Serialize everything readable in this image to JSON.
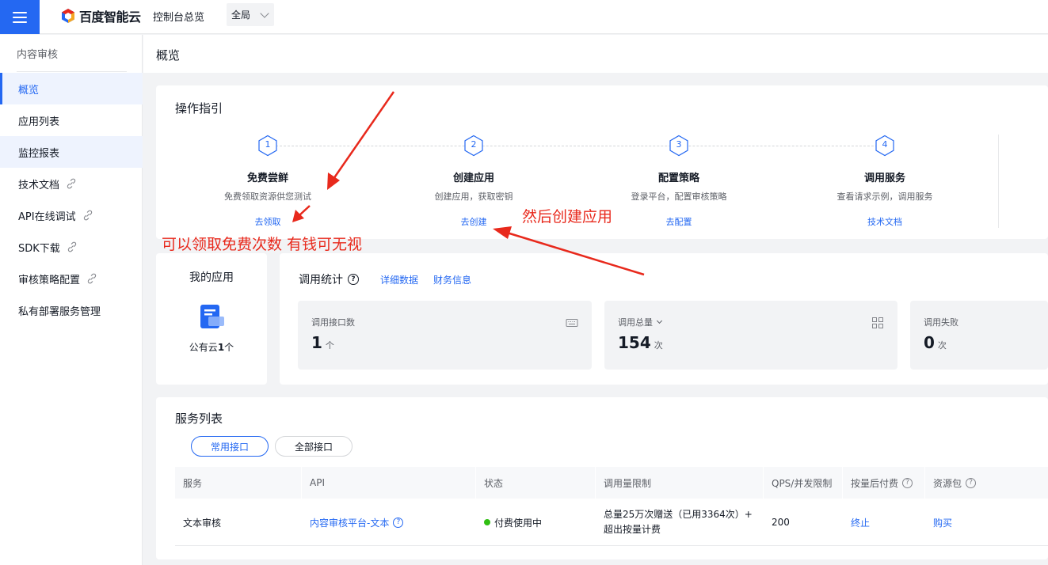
{
  "topbar": {
    "logo_text": "百度智能云",
    "console_link": "控制台总览",
    "region": "全局"
  },
  "sidebar": {
    "title": "内容审核",
    "items": [
      {
        "label": "概览",
        "external": false
      },
      {
        "label": "应用列表",
        "external": false
      },
      {
        "label": "监控报表",
        "external": false
      },
      {
        "label": "技术文档",
        "external": true
      },
      {
        "label": "API在线调试",
        "external": true
      },
      {
        "label": "SDK下载",
        "external": true
      },
      {
        "label": "审核策略配置",
        "external": true
      },
      {
        "label": "私有部署服务管理",
        "external": false
      }
    ]
  },
  "page": {
    "title": "概览"
  },
  "guide": {
    "title": "操作指引",
    "steps": [
      {
        "num": "1",
        "title": "免费尝鲜",
        "desc": "免费领取资源供您测试",
        "link": "去领取"
      },
      {
        "num": "2",
        "title": "创建应用",
        "desc": "创建应用，获取密钥",
        "link": "去创建"
      },
      {
        "num": "3",
        "title": "配置策略",
        "desc": "登录平台，配置审核策略",
        "link": "去配置"
      },
      {
        "num": "4",
        "title": "调用服务",
        "desc": "查看请求示例，调用服务",
        "link": "技术文档"
      }
    ]
  },
  "my_app": {
    "title": "我的应用",
    "count_prefix": "公有云",
    "count": "1",
    "count_unit": "个"
  },
  "stats": {
    "title": "调用统计",
    "link_detail": "详细数据",
    "link_finance": "财务信息",
    "boxes": [
      {
        "label": "调用接口数",
        "value": "1",
        "unit": "个"
      },
      {
        "label": "调用总量",
        "value": "154",
        "unit": "次"
      },
      {
        "label": "调用失败",
        "value": "0",
        "unit": "次"
      }
    ]
  },
  "services": {
    "title": "服务列表",
    "tabs": [
      "常用接口",
      "全部接口"
    ],
    "columns": [
      "服务",
      "API",
      "状态",
      "调用量限制",
      "QPS/并发限制",
      "按量后付费",
      "资源包"
    ],
    "rows": [
      {
        "service": "文本审核",
        "api": "内容审核平台-文本",
        "status": "付费使用中",
        "quota_line1": "总量25万次赠送（已用3364次）+",
        "quota_line2": "超出按量计费",
        "qps": "200",
        "postpaid": "终止",
        "package": "购买"
      }
    ]
  },
  "annotations": {
    "claim_note": "可以领取免费次数 有钱可无视",
    "create_note": "然后创建应用",
    "color": "#e8291c"
  },
  "colors": {
    "brand": "#2468f2",
    "status_ok": "#30bf13"
  }
}
